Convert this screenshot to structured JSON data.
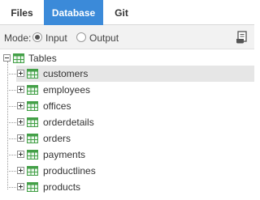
{
  "tabs": [
    {
      "label": "Files",
      "active": false
    },
    {
      "label": "Database",
      "active": true
    },
    {
      "label": "Git",
      "active": false
    }
  ],
  "mode": {
    "label": "Mode:",
    "options": [
      "Input",
      "Output"
    ],
    "selected": "Input"
  },
  "tree": {
    "root_label": "Tables",
    "items": [
      {
        "label": "customers",
        "selected": true
      },
      {
        "label": "employees",
        "selected": false
      },
      {
        "label": "offices",
        "selected": false
      },
      {
        "label": "orderdetails",
        "selected": false
      },
      {
        "label": "orders",
        "selected": false
      },
      {
        "label": "payments",
        "selected": false
      },
      {
        "label": "productlines",
        "selected": false
      },
      {
        "label": "products",
        "selected": false
      }
    ]
  },
  "colors": {
    "accent": "#3b8ad9",
    "table_icon": "#4caf50",
    "selection": "#e6e6e6"
  },
  "icons": {
    "script": "script-icon",
    "expand": "plus-icon",
    "collapse": "minus-icon",
    "table": "table-icon"
  }
}
